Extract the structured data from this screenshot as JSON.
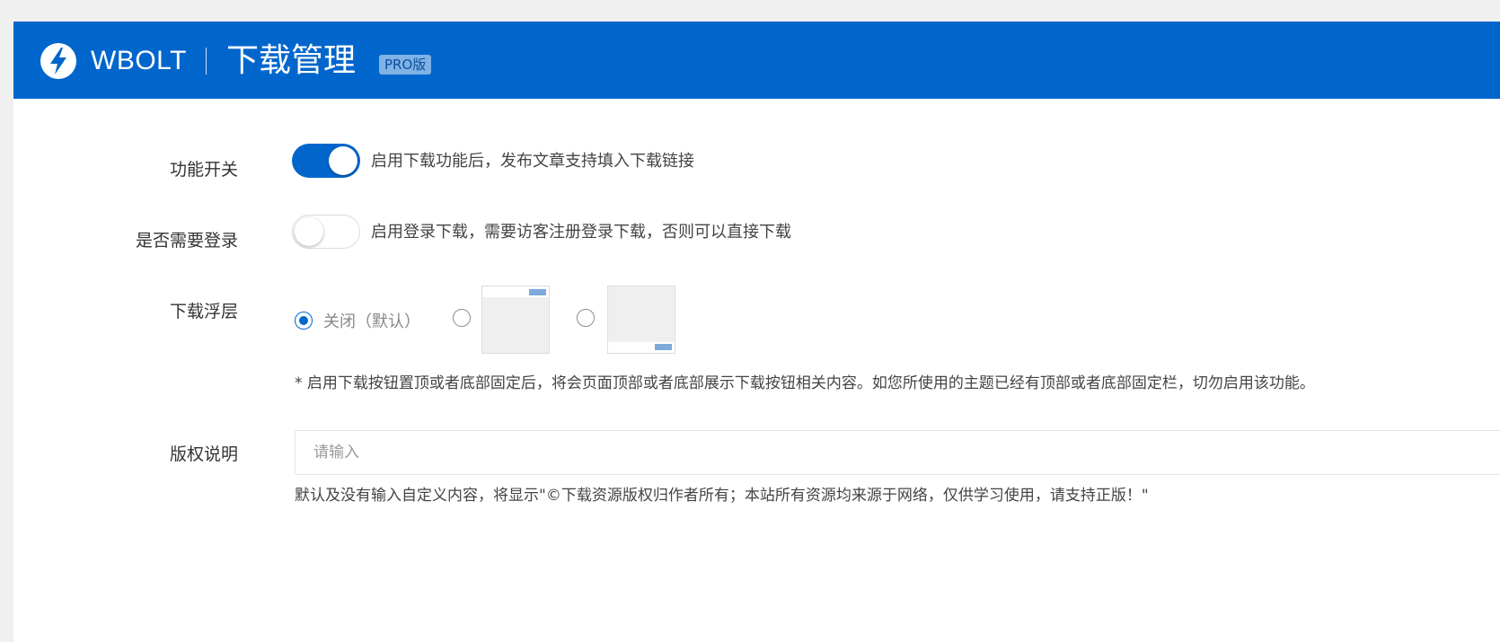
{
  "header": {
    "brand": "WBOLT",
    "title": "下载管理",
    "badge": "PRO版"
  },
  "settings": {
    "feature_switch": {
      "label": "功能开关",
      "enabled": true,
      "description": "启用下载功能后，发布文章支持填入下载链接"
    },
    "login_required": {
      "label": "是否需要登录",
      "enabled": false,
      "description": "启用登录下载，需要访客注册登录下载，否则可以直接下载"
    },
    "download_overlay": {
      "label": "下载浮层",
      "options": [
        {
          "label": "关闭（默认）",
          "selected": true
        },
        {
          "preview": "top-fixed",
          "selected": false
        },
        {
          "preview": "bottom-fixed",
          "selected": false
        }
      ],
      "note": "* 启用下载按钮置顶或者底部固定后，将会页面顶部或者底部展示下载按钮相关内容。如您所使用的主题已经有顶部或者底部固定栏，切勿启用该功能。"
    },
    "copyright": {
      "label": "版权说明",
      "value": "",
      "placeholder": "请输入",
      "help": "默认及没有输入自定义内容，将显示\"©下载资源版权归作者所有；本站所有资源均来源于网络，仅供学习使用，请支持正版！\""
    }
  },
  "colors": {
    "header_bg": "#0066cc",
    "accent": "#0066cc",
    "badge_bg": "#7fb2e5"
  }
}
